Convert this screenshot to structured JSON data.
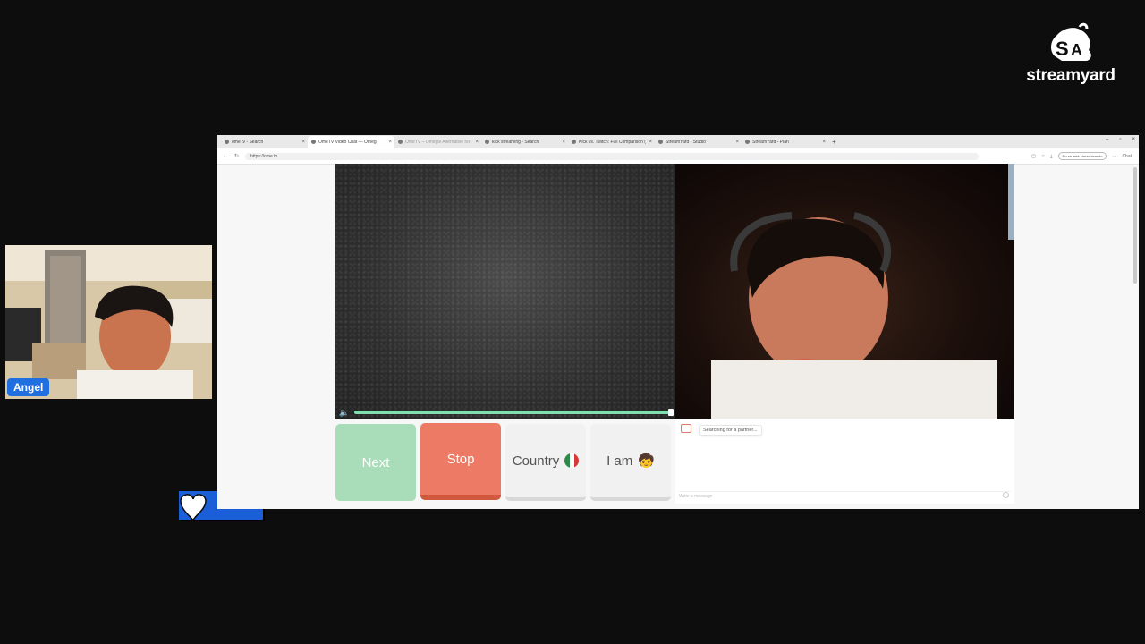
{
  "brand": {
    "name": "streamyard"
  },
  "participant": {
    "name": "Angel"
  },
  "browser": {
    "tabs": [
      {
        "label": "ome tv - Search",
        "active": false,
        "dim": false
      },
      {
        "label": "OmeTV Video Chat — Omegl",
        "active": true,
        "dim": false
      },
      {
        "label": "OmeTV – Omegle Alternative for",
        "active": false,
        "dim": true
      },
      {
        "label": "kick streaming - Search",
        "active": false,
        "dim": false
      },
      {
        "label": "Kick vs. Twitch: Full Comparison (",
        "active": false,
        "dim": false
      },
      {
        "label": "StreamYard - Studio",
        "active": false,
        "dim": false
      },
      {
        "label": "StreamYard - Plan",
        "active": false,
        "dim": false
      }
    ],
    "url": "https://ome.tv",
    "profile_label": "No se está sincronizando",
    "chat_button": "Chat"
  },
  "ometv": {
    "buttons": {
      "next": "Next",
      "stop": "Stop",
      "country": "Country",
      "iam": "I am"
    },
    "chat": {
      "status": "Searching for a partner...",
      "placeholder": "Write a message"
    },
    "progress_fraction": 1.0
  },
  "colors": {
    "next_green": "#a9dcb9",
    "stop_red": "#ec7a65",
    "progress_green": "#7fdfb0",
    "name_tag_blue": "#1f6fe0"
  }
}
